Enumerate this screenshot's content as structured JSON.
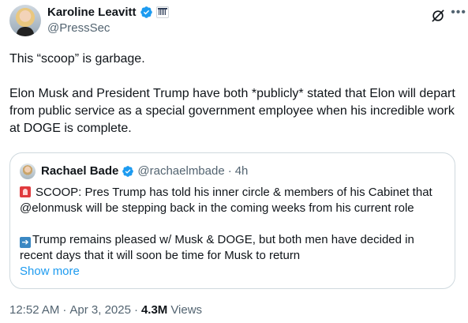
{
  "author": {
    "display_name": "Karoline Leavitt",
    "handle": "@PressSec"
  },
  "tweet": {
    "line1": "This “scoop” is garbage.",
    "line2": "Elon Musk and President Trump have both *publicly* stated that Elon will depart from public service as a special government employee when his incredible work at DOGE is complete."
  },
  "quote": {
    "display_name": "Rachael Bade",
    "handle": "@rachaelmbade",
    "separator": "·",
    "time": "4h",
    "para1": "SCOOP:  Pres Trump has told his inner circle & members of his Cabinet that @elonmusk  will be stepping back in the coming weeks from his current role",
    "para2": "Trump remains pleased w/ Musk & DOGE, but both men have decided in recent days that it will soon be time for Musk to return",
    "show_more": "Show more"
  },
  "footer": {
    "time": "12:52 AM",
    "sep1": "·",
    "date": "Apr 3, 2025",
    "sep2": "·",
    "views_count": "4.3M",
    "views_label": "Views"
  },
  "icons": {
    "verified_badge": "verified-check-badge",
    "affiliate": "government-building-badge",
    "grok": "grok-icon",
    "more": "more-horizontal-icon",
    "alert_emoji": "rotating-light-emoji",
    "arrow_emoji": "right-arrow-emoji"
  },
  "colors": {
    "text": "#0f1419",
    "secondary": "#536471",
    "link": "#1d9bf0",
    "verified": "#1d9bf0",
    "border": "#cfd9de"
  }
}
